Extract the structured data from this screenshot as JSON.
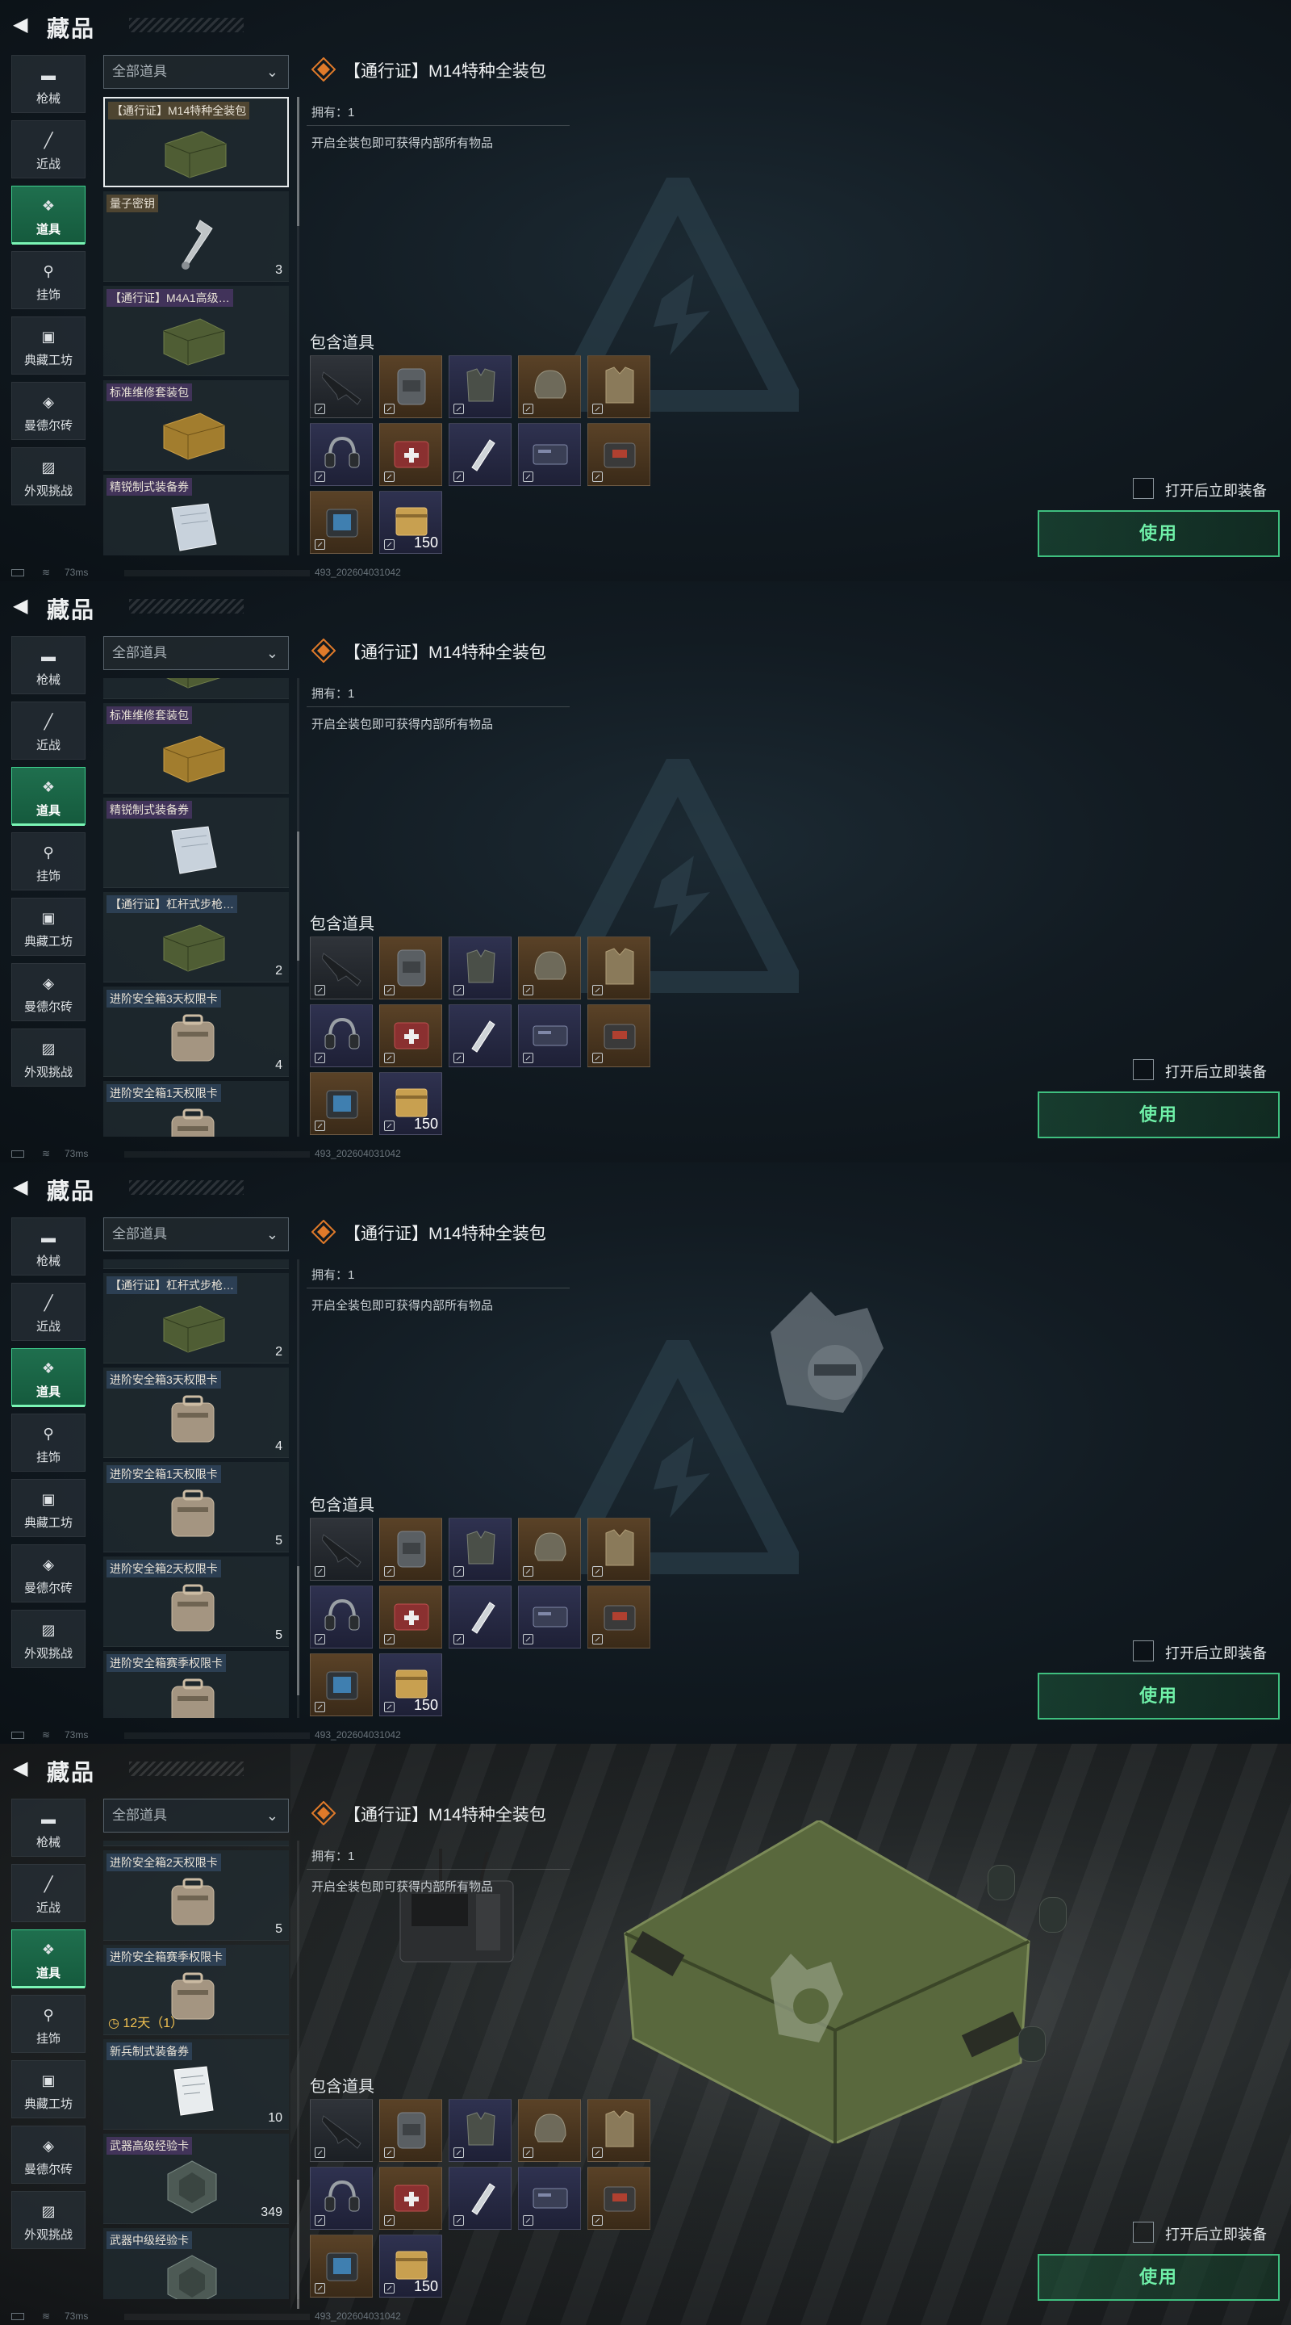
{
  "header": {
    "title": "藏品"
  },
  "categories": [
    {
      "label": "枪械",
      "icon": "gun-icon"
    },
    {
      "label": "近战",
      "icon": "knife-icon"
    },
    {
      "label": "道具",
      "icon": "items-icon",
      "active": true
    },
    {
      "label": "挂饰",
      "icon": "charm-icon"
    },
    {
      "label": "典藏工坊",
      "icon": "workshop-icon"
    },
    {
      "label": "曼德尔砖",
      "icon": "brick-icon"
    },
    {
      "label": "外观挑战",
      "icon": "challenge-icon"
    }
  ],
  "filter": {
    "label": "全部道具"
  },
  "items": [
    {
      "label": "【通行证】M14特种全装包",
      "qty": "",
      "tag": "gold",
      "thumb": "green-crate"
    },
    {
      "label": "量子密钥",
      "qty": "3",
      "tag": "gold",
      "thumb": "key"
    },
    {
      "label": "【通行证】M4A1高级…",
      "qty": "",
      "tag": "purple",
      "thumb": "green-crate"
    },
    {
      "label": "标准维修套装包",
      "qty": "",
      "tag": "purple",
      "thumb": "yellow-box"
    },
    {
      "label": "精锐制式装备券",
      "qty": "",
      "tag": "purple",
      "thumb": "paper"
    },
    {
      "label": "【通行证】杠杆式步枪…",
      "qty": "2",
      "tag": "blue",
      "thumb": "green-crate"
    },
    {
      "label": "进阶安全箱3天权限卡",
      "qty": "4",
      "tag": "blue",
      "thumb": "safe-case"
    },
    {
      "label": "进阶安全箱1天权限卡",
      "qty": "5",
      "tag": "blue",
      "thumb": "safe-case"
    },
    {
      "label": "进阶安全箱2天权限卡",
      "qty": "5",
      "tag": "blue",
      "thumb": "safe-case"
    },
    {
      "label": "进阶安全箱赛季权限卡",
      "qty": "",
      "timer": "12天（1）",
      "tag": "blue",
      "thumb": "safe-case"
    },
    {
      "label": "新兵制式装备券",
      "qty": "10",
      "tag": "blue",
      "thumb": "paper-white"
    },
    {
      "label": "武器高级经验卡",
      "qty": "349",
      "tag": "purple",
      "thumb": "exp-card"
    },
    {
      "label": "武器中级经验卡",
      "qty": "",
      "tag": "blue",
      "thumb": "exp-card"
    }
  ],
  "detail": {
    "title": "【通行证】M14特种全装包",
    "owned": "拥有：1",
    "description": "开启全装包即可获得内部所有物品",
    "contains_label": "包含道具",
    "contents": [
      {
        "icon": "rifle-icon",
        "bg": "dark",
        "count": ""
      },
      {
        "icon": "backpack-icon",
        "bg": "brown",
        "count": ""
      },
      {
        "icon": "chest-rig-icon",
        "bg": "purple",
        "count": ""
      },
      {
        "icon": "helmet-icon",
        "bg": "brown",
        "count": ""
      },
      {
        "icon": "armor-vest-icon",
        "bg": "brown",
        "count": ""
      },
      {
        "icon": "headset-icon",
        "bg": "purple",
        "count": ""
      },
      {
        "icon": "medkit-icon",
        "bg": "brown",
        "count": ""
      },
      {
        "icon": "syringe-icon",
        "bg": "purple",
        "count": ""
      },
      {
        "icon": "keycard-icon",
        "bg": "purple",
        "count": ""
      },
      {
        "icon": "repair-kit-icon",
        "bg": "brown",
        "count": ""
      },
      {
        "icon": "battery-pack-icon",
        "bg": "brown",
        "count": ""
      },
      {
        "icon": "ammo-box-icon",
        "bg": "purple",
        "count": "150"
      }
    ],
    "equip_label": "打开后立即装备",
    "use_label": "使用"
  },
  "status": {
    "ping": "73ms",
    "code": "493_202604031042"
  },
  "colors": {
    "accent": "#3fbf7f",
    "active_tab": "#1f6f4e",
    "bg": "#121b22"
  }
}
